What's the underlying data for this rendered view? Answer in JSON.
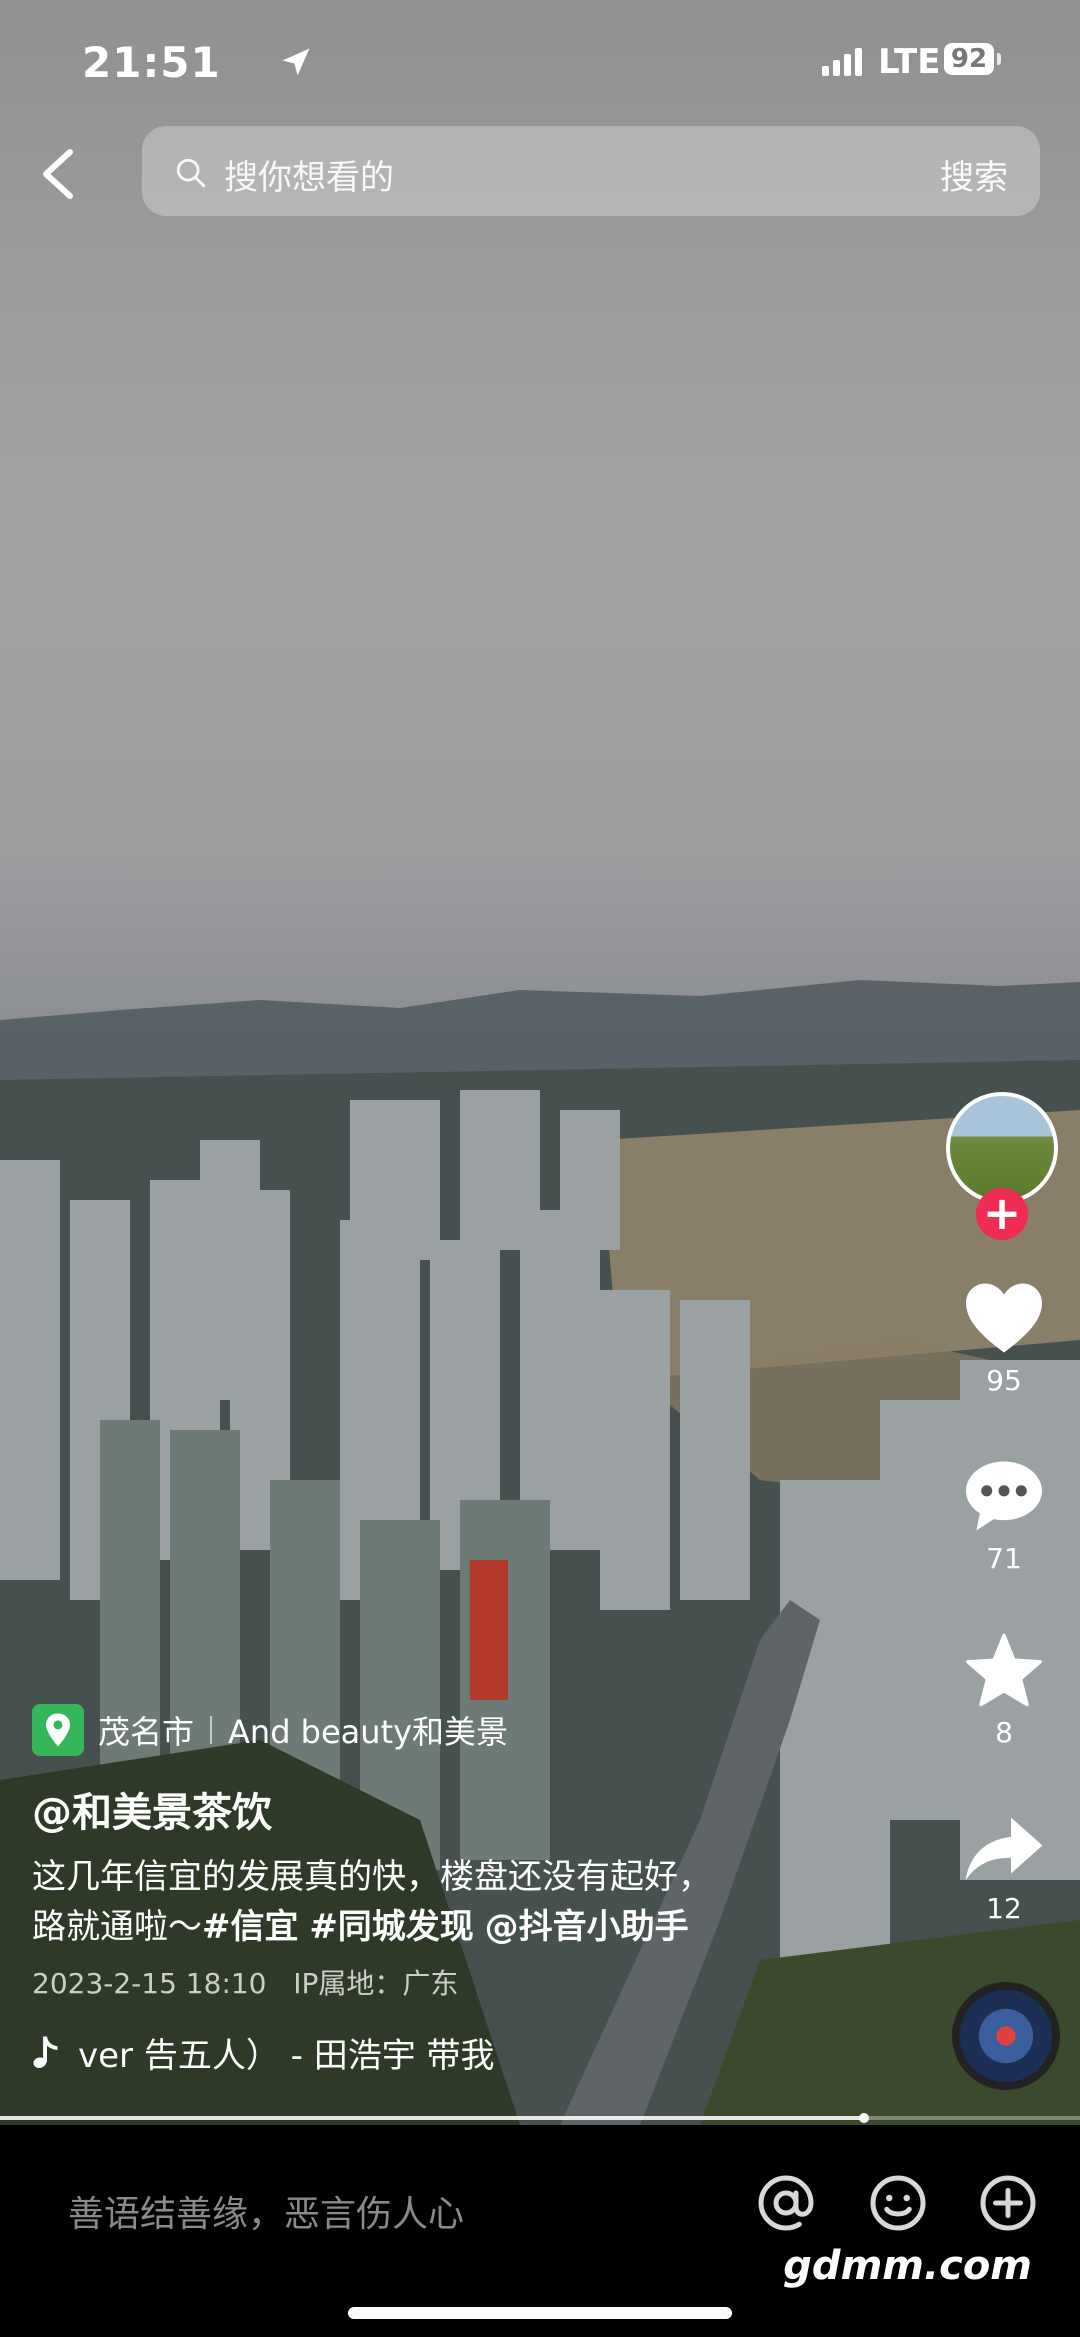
{
  "status_bar": {
    "time": "21:51",
    "network": "LTE",
    "battery": "92"
  },
  "search": {
    "placeholder": "搜你想看的",
    "button": "搜索"
  },
  "sidebar": {
    "likes": "95",
    "comments": "71",
    "favorites": "8",
    "shares": "12"
  },
  "info": {
    "location": "茂名市",
    "location_poi": "And beauty和美景",
    "author": "@和美景茶饮",
    "desc_line1": "这几年信宜的发展真的快，楼盘还没有起好，",
    "desc_line2_prefix": "路就通啦～",
    "tags": [
      "#信宜",
      "#同城发现",
      "@抖音小助手"
    ],
    "date": "2023-2-15 18:10",
    "ip": "IP属地：广东",
    "music": "ver 告五人） - 田浩宇    带我"
  },
  "progress": {
    "fraction": 0.8
  },
  "bottom": {
    "comment_placeholder": "善语结善缘，恶言伤人心",
    "watermark": "gdmm.com"
  },
  "icons": [
    "location-arrow-icon",
    "back-icon",
    "search-icon",
    "heart-icon",
    "comment-icon",
    "star-icon",
    "share-icon",
    "music-note-icon",
    "at-icon",
    "emoji-icon",
    "add-icon",
    "map-pin-icon"
  ],
  "colors": {
    "follow": "#f02b54",
    "pin": "#35b65a"
  }
}
